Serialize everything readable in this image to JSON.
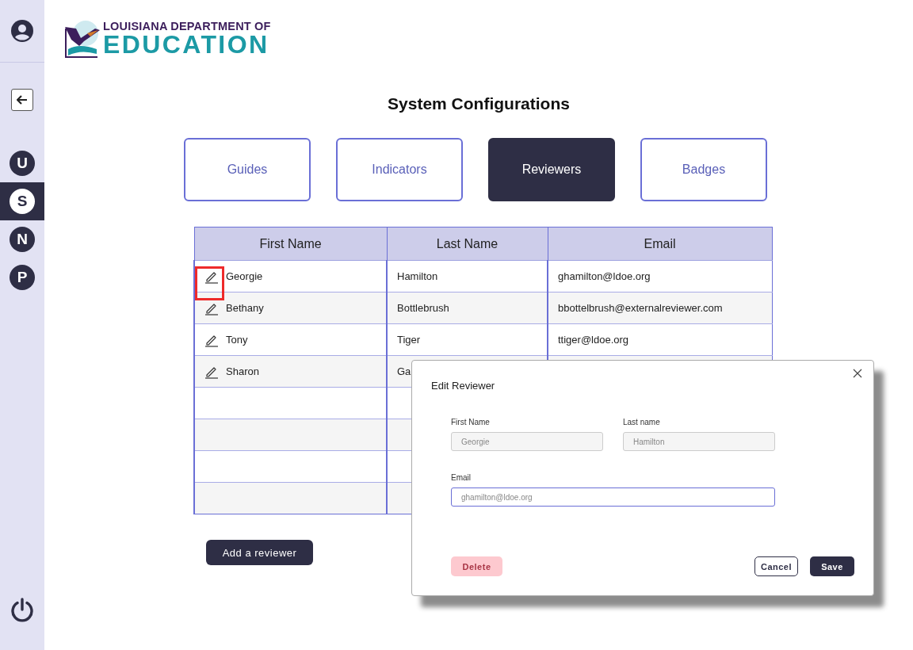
{
  "sidebar": {
    "items": [
      {
        "letter": "U",
        "selected": false
      },
      {
        "letter": "S",
        "selected": true
      },
      {
        "letter": "N",
        "selected": false
      },
      {
        "letter": "P",
        "selected": false
      }
    ]
  },
  "logo": {
    "line_1": "LOUISIANA DEPARTMENT OF",
    "line_2": "EDUCATION"
  },
  "title": "System Configurations",
  "tabs": [
    {
      "label": "Guides",
      "selected": false
    },
    {
      "label": "Indicators",
      "selected": false
    },
    {
      "label": "Reviewers",
      "selected": true
    },
    {
      "label": "Badges",
      "selected": false
    }
  ],
  "table": {
    "columns": [
      "First Name",
      "Last Name",
      "Email"
    ],
    "rows": [
      {
        "first_name": "Georgie",
        "last_name": "Hamilton",
        "email": "ghamilton@ldoe.org",
        "highlighted": true
      },
      {
        "first_name": "Bethany",
        "last_name": "Bottlebrush",
        "email": "bbottelbrush@externalreviewer.com",
        "highlighted": false
      },
      {
        "first_name": "Tony",
        "last_name": "Tiger",
        "email": "ttiger@ldoe.org",
        "highlighted": false
      },
      {
        "first_name": "Sharon",
        "last_name": "Ga",
        "highlighted": false
      }
    ]
  },
  "add_button": "Add a reviewer",
  "dialog": {
    "title": "Edit Reviewer",
    "fields": [
      {
        "label": "First Name",
        "value": "Georgie",
        "disabled": true
      },
      {
        "label": "Last name",
        "value": "Hamilton",
        "disabled": true
      },
      {
        "label": "Email",
        "value": "ghamilton@ldoe.org",
        "disabled": false
      }
    ],
    "delete_button": "Delete",
    "cancel_button": "Cancel",
    "save_button": "Save"
  }
}
